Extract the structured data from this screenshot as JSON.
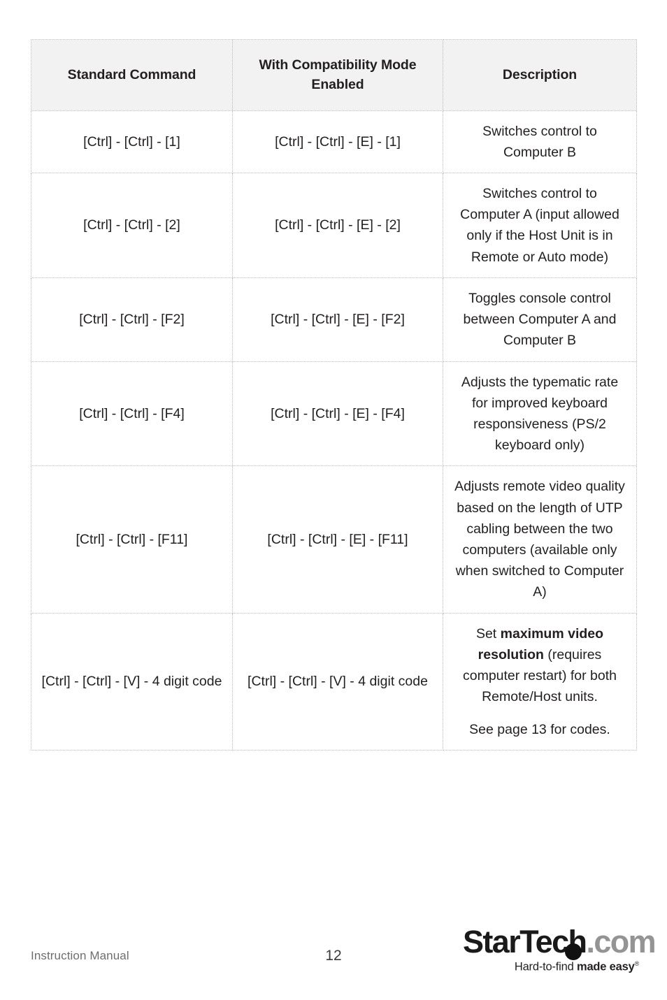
{
  "document": {
    "page_number": "12",
    "footer_label": "Instruction Manual"
  },
  "table": {
    "headers": [
      "Standard Command",
      "With Compatibility Mode Enabled",
      "Description"
    ],
    "rows": [
      {
        "standard_command": "[Ctrl] - [Ctrl] - [1]",
        "compatibility_command": "[Ctrl] - [Ctrl] - [E] - [1]",
        "description": "Switches control to Computer B"
      },
      {
        "standard_command": "[Ctrl] - [Ctrl] - [2]",
        "compatibility_command": "[Ctrl] - [Ctrl] - [E] - [2]",
        "description": "Switches control to Computer A (input allowed only if the Host Unit is in Remote or Auto mode)"
      },
      {
        "standard_command": "[Ctrl] - [Ctrl] - [F2]",
        "compatibility_command": "[Ctrl] - [Ctrl] - [E] - [F2]",
        "description": "Toggles console control between Computer A and Computer B"
      },
      {
        "standard_command": "[Ctrl] - [Ctrl] - [F4]",
        "compatibility_command": "[Ctrl] - [Ctrl] - [E] - [F4]",
        "description": "Adjusts the typematic rate for improved keyboard responsiveness (PS/2 keyboard only)"
      },
      {
        "standard_command": "[Ctrl] - [Ctrl] - [F11]",
        "compatibility_command": "[Ctrl] - [Ctrl] - [E] - [F11]",
        "description": "Adjusts remote video quality based on the length of UTP cabling between the two computers (available only when switched to Computer A)"
      },
      {
        "standard_command": "[Ctrl] - [Ctrl] - [V] - 4 digit code",
        "compatibility_command": "[Ctrl] - [Ctrl] - [V] - 4 digit code",
        "description_parts": {
          "prefix": "Set ",
          "bold": "maximum video resolution",
          "suffix": " (requires computer restart) for both Remote/Host units.",
          "second_paragraph": "See page 13 for codes."
        }
      }
    ]
  },
  "logo": {
    "brand_primary": "StarTech",
    "brand_secondary": ".com",
    "tagline_regular": "Hard-to-find ",
    "tagline_bold": "made easy",
    "tagline_mark": "®",
    "colors": {
      "brand_primary": "#1a1a1a",
      "brand_secondary": "#949494",
      "dot": "#111111"
    }
  },
  "theme": {
    "page_background": "#ffffff",
    "header_background": "#f2f2f2",
    "border_color": "#b9b9b9",
    "text_color": "#231f20",
    "muted_text_color": "#6d6e71"
  }
}
